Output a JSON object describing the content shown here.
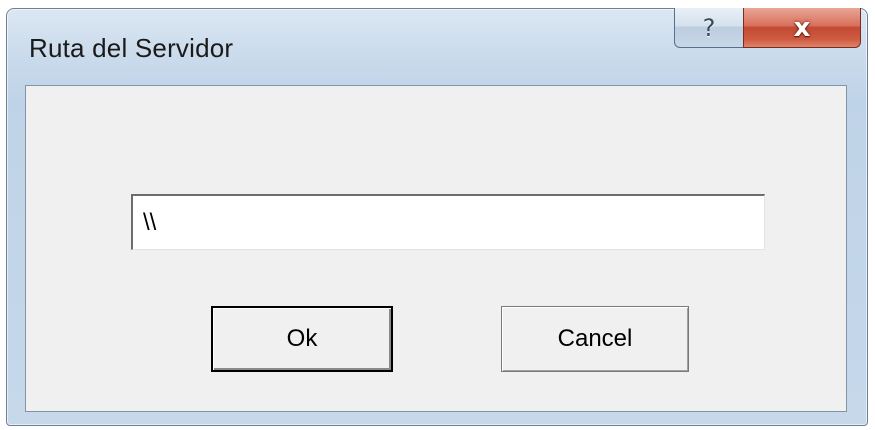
{
  "window": {
    "title": "Ruta del Servidor"
  },
  "caption_buttons": {
    "help_icon": "question-mark",
    "help_glyph": "?",
    "close_icon": "close-x",
    "close_glyph": "x"
  },
  "form": {
    "server_path_value": "\\\\"
  },
  "buttons": {
    "ok_label": "Ok",
    "cancel_label": "Cancel"
  },
  "colors": {
    "close_button": "#c34a33",
    "client_background": "#f0f0f0"
  }
}
